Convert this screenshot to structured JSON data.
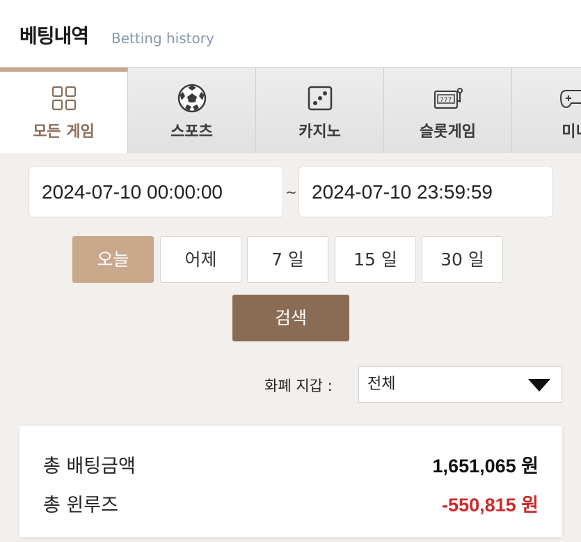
{
  "header": {
    "title": "베팅내역",
    "subtitle": "Betting history"
  },
  "tabs": [
    {
      "label": "모든 게임",
      "icon": "grid-icon",
      "active": true
    },
    {
      "label": "스포츠",
      "icon": "soccer-ball-icon",
      "active": false
    },
    {
      "label": "카지노",
      "icon": "dice-icon",
      "active": false
    },
    {
      "label": "슬롯게임",
      "icon": "slot-machine-icon",
      "active": false
    },
    {
      "label": "미니",
      "icon": "gamepad-icon",
      "active": false
    }
  ],
  "date_range": {
    "start": "2024-07-10 00:00:00",
    "separator": "~",
    "end": "2024-07-10 23:59:59"
  },
  "quick_ranges": [
    {
      "label": "오늘",
      "active": true
    },
    {
      "label": "어제",
      "active": false
    },
    {
      "label": "7 일",
      "active": false
    },
    {
      "label": "15 일",
      "active": false
    },
    {
      "label": "30 일",
      "active": false
    }
  ],
  "search_label": "검색",
  "wallet": {
    "label": "화폐 지갑 :",
    "selected": "전체"
  },
  "summary": {
    "total_bet_label": "총 배팅금액",
    "total_bet_value": "1,651,065 원",
    "total_winloss_label": "총 윈루즈",
    "total_winloss_value": "-550,815 원"
  },
  "colors": {
    "accent": "#c9a88c",
    "search_button": "#8a6c54",
    "negative": "#cc2a2a",
    "subtitle": "#8597ad"
  }
}
